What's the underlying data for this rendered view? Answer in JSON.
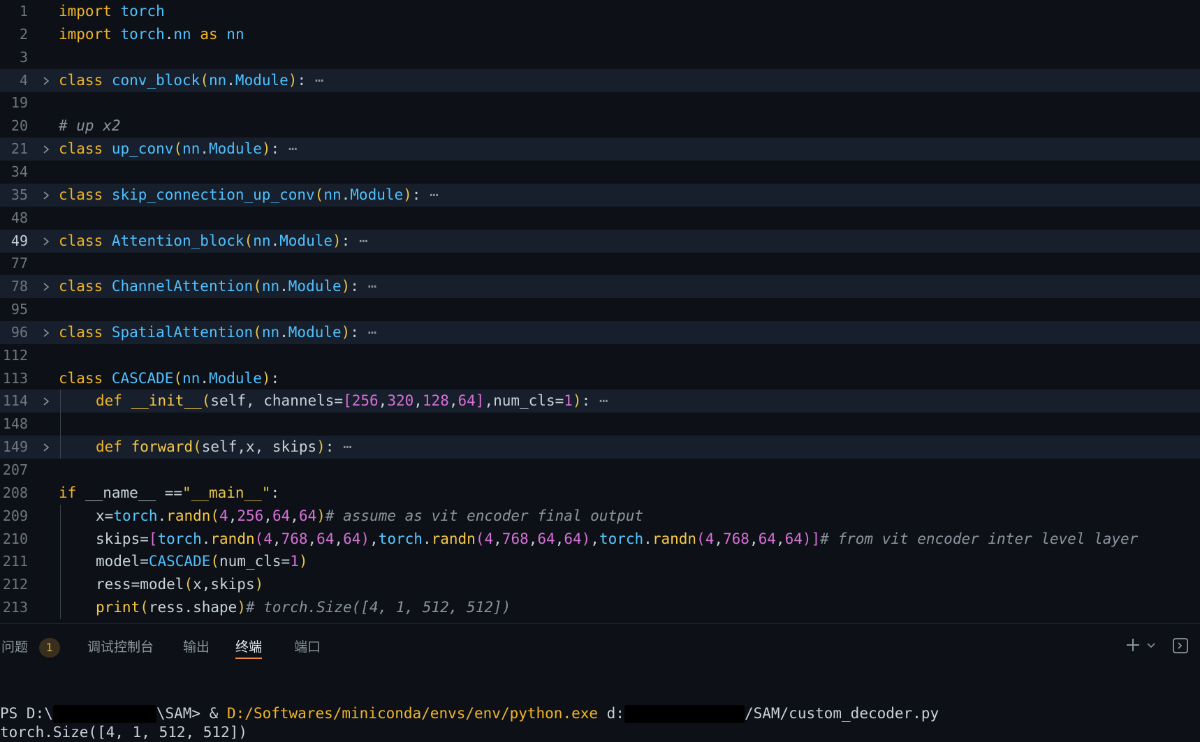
{
  "editor": {
    "lines": [
      {
        "n": "1",
        "tokens": [
          [
            "kw",
            "import"
          ],
          [
            "var",
            " "
          ],
          [
            "cls",
            "torch"
          ]
        ]
      },
      {
        "n": "2",
        "tokens": [
          [
            "kw",
            "import"
          ],
          [
            "var",
            " "
          ],
          [
            "cls",
            "torch"
          ],
          [
            "var",
            "."
          ],
          [
            "cls",
            "nn"
          ],
          [
            "var",
            " "
          ],
          [
            "kw",
            "as"
          ],
          [
            "var",
            " "
          ],
          [
            "cls",
            "nn"
          ]
        ]
      },
      {
        "n": "3",
        "tokens": []
      },
      {
        "n": "4",
        "fold": true,
        "tokens": [
          [
            "kw",
            "class"
          ],
          [
            "var",
            " "
          ],
          [
            "cls",
            "conv_block"
          ],
          [
            "par",
            "("
          ],
          [
            "cls",
            "nn"
          ],
          [
            "var",
            "."
          ],
          [
            "cls",
            "Module"
          ],
          [
            "par",
            ")"
          ],
          [
            "var",
            ":"
          ],
          [
            "dots",
            " ⋯"
          ]
        ]
      },
      {
        "n": "19",
        "tokens": []
      },
      {
        "n": "20",
        "tokens": [
          [
            "cm",
            "# up x2"
          ]
        ]
      },
      {
        "n": "21",
        "fold": true,
        "tokens": [
          [
            "kw",
            "class"
          ],
          [
            "var",
            " "
          ],
          [
            "cls",
            "up_conv"
          ],
          [
            "par",
            "("
          ],
          [
            "cls",
            "nn"
          ],
          [
            "var",
            "."
          ],
          [
            "cls",
            "Module"
          ],
          [
            "par",
            ")"
          ],
          [
            "var",
            ":"
          ],
          [
            "dots",
            " ⋯"
          ]
        ]
      },
      {
        "n": "34",
        "tokens": []
      },
      {
        "n": "35",
        "fold": true,
        "tokens": [
          [
            "kw",
            "class"
          ],
          [
            "var",
            " "
          ],
          [
            "cls",
            "skip_connection_up_conv"
          ],
          [
            "par",
            "("
          ],
          [
            "cls",
            "nn"
          ],
          [
            "var",
            "."
          ],
          [
            "cls",
            "Module"
          ],
          [
            "par",
            ")"
          ],
          [
            "var",
            ":"
          ],
          [
            "dots",
            " ⋯"
          ]
        ]
      },
      {
        "n": "48",
        "tokens": []
      },
      {
        "n": "49",
        "fold": true,
        "active": true,
        "tokens": [
          [
            "kw",
            "class"
          ],
          [
            "var",
            " "
          ],
          [
            "cls",
            "Attention_block"
          ],
          [
            "par",
            "("
          ],
          [
            "cls",
            "nn"
          ],
          [
            "var",
            "."
          ],
          [
            "cls",
            "Module"
          ],
          [
            "par",
            ")"
          ],
          [
            "var",
            ":"
          ],
          [
            "dots",
            " ⋯"
          ]
        ]
      },
      {
        "n": "77",
        "tokens": []
      },
      {
        "n": "78",
        "fold": true,
        "tokens": [
          [
            "kw",
            "class"
          ],
          [
            "var",
            " "
          ],
          [
            "cls",
            "ChannelAttention"
          ],
          [
            "par",
            "("
          ],
          [
            "cls",
            "nn"
          ],
          [
            "var",
            "."
          ],
          [
            "cls",
            "Module"
          ],
          [
            "par",
            ")"
          ],
          [
            "var",
            ":"
          ],
          [
            "dots",
            " ⋯"
          ]
        ]
      },
      {
        "n": "95",
        "tokens": []
      },
      {
        "n": "96",
        "fold": true,
        "tokens": [
          [
            "kw",
            "class"
          ],
          [
            "var",
            " "
          ],
          [
            "cls",
            "SpatialAttention"
          ],
          [
            "par",
            "("
          ],
          [
            "cls",
            "nn"
          ],
          [
            "var",
            "."
          ],
          [
            "cls",
            "Module"
          ],
          [
            "par",
            ")"
          ],
          [
            "var",
            ":"
          ],
          [
            "dots",
            " ⋯"
          ]
        ]
      },
      {
        "n": "112",
        "tokens": []
      },
      {
        "n": "113",
        "tokens": [
          [
            "kw",
            "class"
          ],
          [
            "var",
            " "
          ],
          [
            "cls",
            "CASCADE"
          ],
          [
            "par",
            "("
          ],
          [
            "cls",
            "nn"
          ],
          [
            "var",
            "."
          ],
          [
            "cls",
            "Module"
          ],
          [
            "par",
            ")"
          ],
          [
            "var",
            ":"
          ]
        ]
      },
      {
        "n": "114",
        "fold": true,
        "indent": 1,
        "tokens": [
          [
            "kw",
            "def"
          ],
          [
            "var",
            " "
          ],
          [
            "fn",
            "__init__"
          ],
          [
            "par",
            "("
          ],
          [
            "var",
            "self, channels="
          ],
          [
            "br",
            "["
          ],
          [
            "num",
            "256"
          ],
          [
            "var",
            ","
          ],
          [
            "num",
            "320"
          ],
          [
            "var",
            ","
          ],
          [
            "num",
            "128"
          ],
          [
            "var",
            ","
          ],
          [
            "num",
            "64"
          ],
          [
            "br",
            "]"
          ],
          [
            "var",
            ",num_cls="
          ],
          [
            "num",
            "1"
          ],
          [
            "par",
            ")"
          ],
          [
            "var",
            ":"
          ],
          [
            "dots",
            " ⋯"
          ]
        ]
      },
      {
        "n": "148",
        "indent": 1,
        "tokens": []
      },
      {
        "n": "149",
        "fold": true,
        "indent": 1,
        "tokens": [
          [
            "kw",
            "def"
          ],
          [
            "var",
            " "
          ],
          [
            "fn",
            "forward"
          ],
          [
            "par",
            "("
          ],
          [
            "var",
            "self,x, skips"
          ],
          [
            "par",
            ")"
          ],
          [
            "var",
            ":"
          ],
          [
            "dots",
            " ⋯"
          ]
        ]
      },
      {
        "n": "207",
        "tokens": []
      },
      {
        "n": "208",
        "tokens": [
          [
            "kw",
            "if"
          ],
          [
            "var",
            " __name__ =="
          ],
          [
            "str",
            "\"__main__\""
          ],
          [
            "var",
            ":"
          ]
        ]
      },
      {
        "n": "209",
        "indent": 1,
        "tokens": [
          [
            "var",
            "x="
          ],
          [
            "cyan",
            "torch"
          ],
          [
            "var",
            "."
          ],
          [
            "fn",
            "randn"
          ],
          [
            "par",
            "("
          ],
          [
            "num",
            "4"
          ],
          [
            "var",
            ","
          ],
          [
            "num",
            "256"
          ],
          [
            "var",
            ","
          ],
          [
            "num",
            "64"
          ],
          [
            "var",
            ","
          ],
          [
            "num",
            "64"
          ],
          [
            "par",
            ")"
          ],
          [
            "cm",
            "# assume as vit encoder final output"
          ]
        ]
      },
      {
        "n": "210",
        "indent": 1,
        "tokens": [
          [
            "var",
            "skips="
          ],
          [
            "br",
            "["
          ],
          [
            "cyan",
            "torch"
          ],
          [
            "var",
            "."
          ],
          [
            "fn",
            "randn"
          ],
          [
            "pnk",
            "("
          ],
          [
            "num",
            "4"
          ],
          [
            "var",
            ","
          ],
          [
            "num",
            "768"
          ],
          [
            "var",
            ","
          ],
          [
            "num",
            "64"
          ],
          [
            "var",
            ","
          ],
          [
            "num",
            "64"
          ],
          [
            "pnk",
            ")"
          ],
          [
            "var",
            ","
          ],
          [
            "cyan",
            "torch"
          ],
          [
            "var",
            "."
          ],
          [
            "fn",
            "randn"
          ],
          [
            "pnk",
            "("
          ],
          [
            "num",
            "4"
          ],
          [
            "var",
            ","
          ],
          [
            "num",
            "768"
          ],
          [
            "var",
            ","
          ],
          [
            "num",
            "64"
          ],
          [
            "var",
            ","
          ],
          [
            "num",
            "64"
          ],
          [
            "pnk",
            ")"
          ],
          [
            "var",
            ","
          ],
          [
            "cyan",
            "torch"
          ],
          [
            "var",
            "."
          ],
          [
            "fn",
            "randn"
          ],
          [
            "pnk",
            "("
          ],
          [
            "num",
            "4"
          ],
          [
            "var",
            ","
          ],
          [
            "num",
            "768"
          ],
          [
            "var",
            ","
          ],
          [
            "num",
            "64"
          ],
          [
            "var",
            ","
          ],
          [
            "num",
            "64"
          ],
          [
            "pnk",
            ")"
          ],
          [
            "br",
            "]"
          ],
          [
            "cm",
            "# from vit encoder inter level layer"
          ]
        ]
      },
      {
        "n": "211",
        "indent": 1,
        "tokens": [
          [
            "var",
            "model="
          ],
          [
            "cls",
            "CASCADE"
          ],
          [
            "par",
            "("
          ],
          [
            "var",
            "num_cls="
          ],
          [
            "num",
            "1"
          ],
          [
            "par",
            ")"
          ]
        ]
      },
      {
        "n": "212",
        "indent": 1,
        "tokens": [
          [
            "var",
            "ress=model"
          ],
          [
            "par",
            "("
          ],
          [
            "var",
            "x,skips"
          ],
          [
            "par",
            ")"
          ]
        ]
      },
      {
        "n": "213",
        "indent": 1,
        "tokens": [
          [
            "fn",
            "print"
          ],
          [
            "par",
            "("
          ],
          [
            "var",
            "ress.shape"
          ],
          [
            "par",
            ")"
          ],
          [
            "cm",
            "# torch.Size([4, 1, 512, 512])"
          ]
        ]
      }
    ]
  },
  "panel": {
    "tabs": [
      {
        "label": "问题",
        "key": "problems"
      },
      {
        "label": "调试控制台",
        "key": "debug"
      },
      {
        "label": "输出",
        "key": "output"
      },
      {
        "label": "终端",
        "key": "terminal",
        "active": true
      },
      {
        "label": "端口",
        "key": "ports"
      }
    ],
    "problems_count": "1",
    "terminal": {
      "prompt_prefix": "PS D:\\",
      "prompt_mid": "\\SAM> & ",
      "exe": "D:/Softwares/miniconda/envs/env/python.exe",
      "arg_prefix": " d:",
      "arg_suffix": "/SAM/custom_decoder.py",
      "output": "torch.Size([4, 1, 512, 512])"
    }
  }
}
